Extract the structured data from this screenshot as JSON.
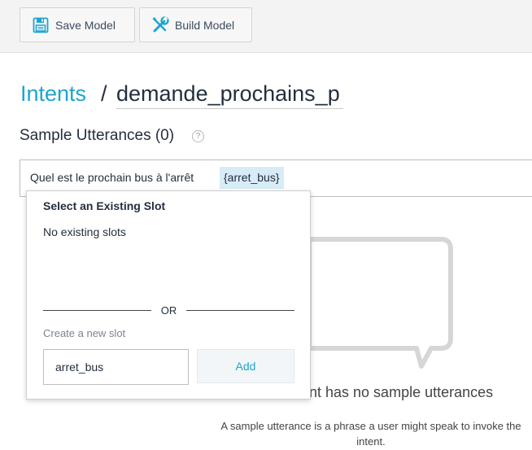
{
  "toolbar": {
    "save_label": "Save Model",
    "build_label": "Build Model",
    "save_icon": "floppy-disk-icon",
    "build_icon": "wrench-screwdriver-icon"
  },
  "breadcrumb": {
    "link": "Intents",
    "separator": "/",
    "intent_name": "demande_prochains_p"
  },
  "sample_utterances": {
    "title": "Sample Utterances (0)",
    "help": "?",
    "input_text": "Quel est le prochain bus à l'arrêt",
    "slot_chip": "{arret_bus}"
  },
  "slot_dropdown": {
    "title": "Select an Existing Slot",
    "empty_text": "No existing slots",
    "or_label": "OR",
    "create_label": "Create a new slot",
    "new_slot_value": "arret_bus",
    "add_label": "Add"
  },
  "empty_state": {
    "title": "nt has no sample utterances",
    "description": "A sample utterance is a phrase a user might speak to invoke the intent."
  },
  "colors": {
    "accent": "#1ea5cf",
    "chip_bg": "#d7ecf7",
    "toolbar_bg": "#f3f3f3"
  }
}
